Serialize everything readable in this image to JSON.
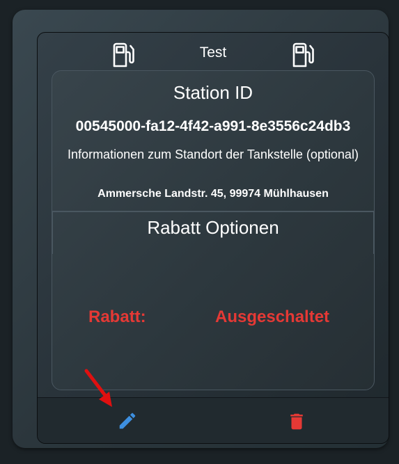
{
  "card": {
    "title": "Test",
    "left_icon": "gas-pump-icon",
    "right_icon": "gas-pump-icon"
  },
  "station": {
    "heading": "Station ID",
    "id": "00545000-fa12-4f42-a991-8e3556c24db3",
    "info_label": "Informationen zum Standort der Tankstelle (optional)",
    "address": "Ammersche Landstr. 45, 99974 Mühlhausen"
  },
  "rabatt": {
    "heading": "Rabatt Optionen",
    "label": "Rabatt:",
    "value": "Ausgeschaltet",
    "status_color": "#e53935"
  },
  "actions": {
    "edit_icon": "pencil-icon",
    "edit_color": "#3d8fe0",
    "delete_icon": "trash-icon",
    "delete_color": "#e53935"
  },
  "annotation": {
    "pointer_icon": "red-arrow-icon",
    "color": "#e01010"
  }
}
